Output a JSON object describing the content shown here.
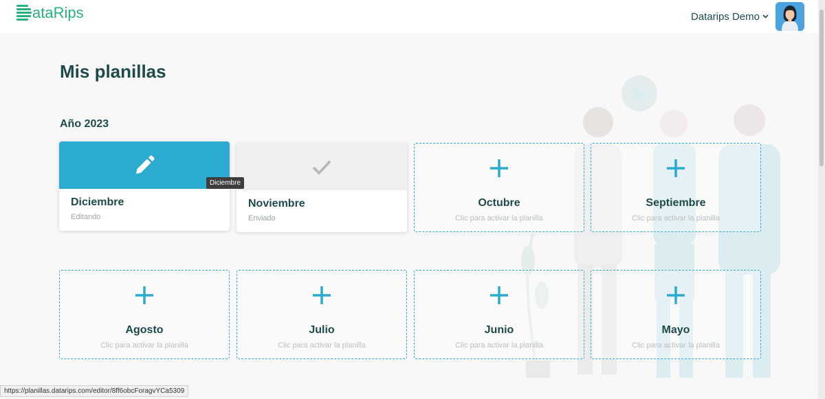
{
  "brand": {
    "logo_text": "ataRips",
    "color": "#27b27d"
  },
  "header": {
    "user_name": "Datarips Demo"
  },
  "main": {
    "title": "Mis planillas",
    "year_label": "Año 2023",
    "active_cards": [
      {
        "month": "Diciembre",
        "status": "Editando",
        "icon": "pencil-icon"
      },
      {
        "month": "Noviembre",
        "status": "Enviado",
        "icon": "check-icon"
      }
    ],
    "empty_cards": [
      {
        "month": "Octubre",
        "hint": "Clic para activar la planilla"
      },
      {
        "month": "Septiembre",
        "hint": "Clic para activar la planilla"
      },
      {
        "month": "Agosto",
        "hint": "Clic para activar la planilla"
      },
      {
        "month": "Julio",
        "hint": "Clic para activar la planilla"
      },
      {
        "month": "Junio",
        "hint": "Clic para activar la planilla"
      },
      {
        "month": "Mayo",
        "hint": "Clic para activar la planilla"
      }
    ]
  },
  "tooltip": "Diciembre",
  "status_bar_url": "https://planillas.datarips.com/editor/8ff6obcForagvYCa5309",
  "colors": {
    "accent": "#2babcf",
    "text": "#1f4a4a"
  }
}
